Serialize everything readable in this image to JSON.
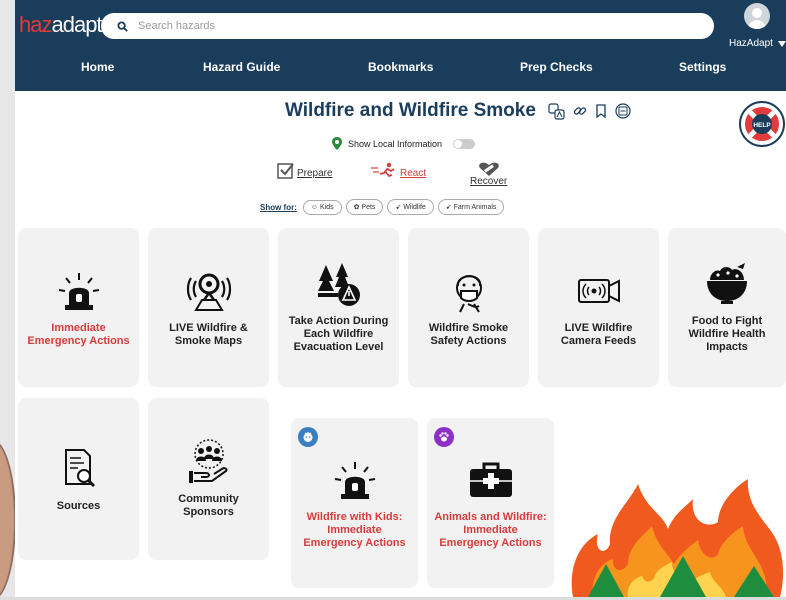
{
  "app": {
    "logo_a": "haz",
    "logo_b": "adapt"
  },
  "search": {
    "placeholder": "Search hazards"
  },
  "user": {
    "name": "HazAdapt"
  },
  "nav": [
    {
      "label": "Home"
    },
    {
      "label": "Hazard Guide"
    },
    {
      "label": "Bookmarks"
    },
    {
      "label": "Prep Checks"
    },
    {
      "label": "Settings"
    }
  ],
  "page": {
    "title": "Wildfire and Wildfire Smoke"
  },
  "help": {
    "label": "HELP"
  },
  "local": {
    "label": "Show Local Information",
    "enabled": false
  },
  "phases": [
    {
      "label": "Prepare",
      "active": false
    },
    {
      "label": "React",
      "active": true
    },
    {
      "label": "Recover",
      "active": false
    }
  ],
  "showfor": {
    "label": "Show for:",
    "chips": [
      "Kids",
      "Pets",
      "Wildlife",
      "Farm Animals"
    ]
  },
  "cards": [
    {
      "label": "Immediate Emergency Actions",
      "icon": "siren-icon",
      "red": true
    },
    {
      "label": "LIVE Wildfire & Smoke Maps",
      "icon": "map-pin-broadcast-icon",
      "red": false
    },
    {
      "label": "Take Action During Each Wildfire Evacuation Level",
      "icon": "forest-warning-icon",
      "red": false
    },
    {
      "label": "Wildfire Smoke Safety Actions",
      "icon": "face-mask-icon",
      "red": false
    },
    {
      "label": "LIVE Wildfire Camera Feeds",
      "icon": "camera-feed-icon",
      "red": false
    },
    {
      "label": "Food to Fight Wildfire Health Impacts",
      "icon": "food-bowl-icon",
      "red": false
    },
    {
      "label": "Sources",
      "icon": "document-search-icon",
      "red": false
    },
    {
      "label": "Community Sponsors",
      "icon": "community-hand-icon",
      "red": false
    },
    {
      "label": "Wildfire with Kids: Immediate Emergency Actions",
      "icon": "siren-icon",
      "red": true,
      "badge": "kids-badge-icon",
      "badge_color": "#3a7fc1"
    },
    {
      "label": "Animals and Wildfire: Immediate Emergency Actions",
      "icon": "first-aid-kit-icon",
      "red": true,
      "badge": "paw-badge-icon",
      "badge_color": "#8e2fc7"
    }
  ],
  "colors": {
    "navy": "#1a3d5c",
    "accent_red": "#d93b3b",
    "card_bg": "#f2f2f2"
  }
}
